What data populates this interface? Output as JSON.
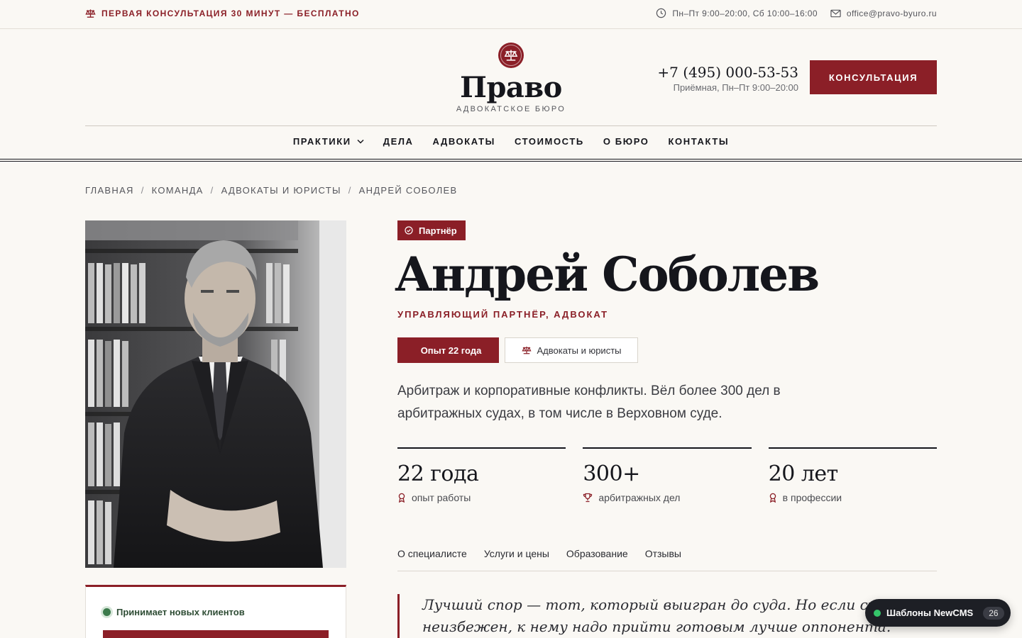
{
  "topbar": {
    "promo": "ПЕРВАЯ КОНСУЛЬТАЦИЯ 30 МИНУТ — БЕСПЛАТНО",
    "hours": "Пн–Пт 9:00–20:00, Сб 10:00–16:00",
    "email": "office@pravo-byuro.ru"
  },
  "header": {
    "logo_title": "Право",
    "logo_subtitle": "АДВОКАТСКОЕ БЮРО",
    "phone": "+7 (495) 000-53-53",
    "phone_note": "Приёмная, Пн–Пт 9:00–20:00",
    "cta_label": "КОНСУЛЬТАЦИЯ"
  },
  "nav": {
    "items": [
      "ПРАКТИКИ",
      "ДЕЛА",
      "АДВОКАТЫ",
      "СТОИМОСТЬ",
      "О БЮРО",
      "КОНТАКТЫ"
    ]
  },
  "breadcrumb": [
    "ГЛАВНАЯ",
    "КОМАНДА",
    "АДВОКАТЫ И ЮРИСТЫ",
    "АНДРЕЙ СОБОЛЕВ"
  ],
  "profile": {
    "badge": "Партнёр",
    "name": "Андрей Соболев",
    "role": "УПРАВЛЯЮЩИЙ ПАРТНЁР, АДВОКАТ",
    "experience_chip": "Опыт 22 года",
    "category_chip": "Адвокаты и юристы",
    "lead": "Арбитраж и корпоративные конфликты. Вёл более 300 дел в арбитражных судах, в том числе в Верховном суде.",
    "stats": [
      {
        "value": "22 года",
        "label": "опыт работы",
        "icon": "award-icon"
      },
      {
        "value": "300+",
        "label": "арбитражных дел",
        "icon": "trophy-icon"
      },
      {
        "value": "20 лет",
        "label": "в профессии",
        "icon": "award-icon"
      }
    ],
    "tabs": [
      "О специалисте",
      "Услуги и цены",
      "Образование",
      "Отзывы"
    ],
    "quote": "Лучший спор — тот, который выигран до суда. Но если суд неизбежен, к нему надо прийти готовым лучше оппонента."
  },
  "status": {
    "accepting": "Принимает новых клиентов"
  },
  "widget": {
    "label": "Шаблоны NewCMS",
    "count": "26"
  },
  "colors": {
    "accent": "#8b1f27",
    "text": "#15161c",
    "background": "#faf8f4",
    "status_green": "#3c7a4c"
  }
}
